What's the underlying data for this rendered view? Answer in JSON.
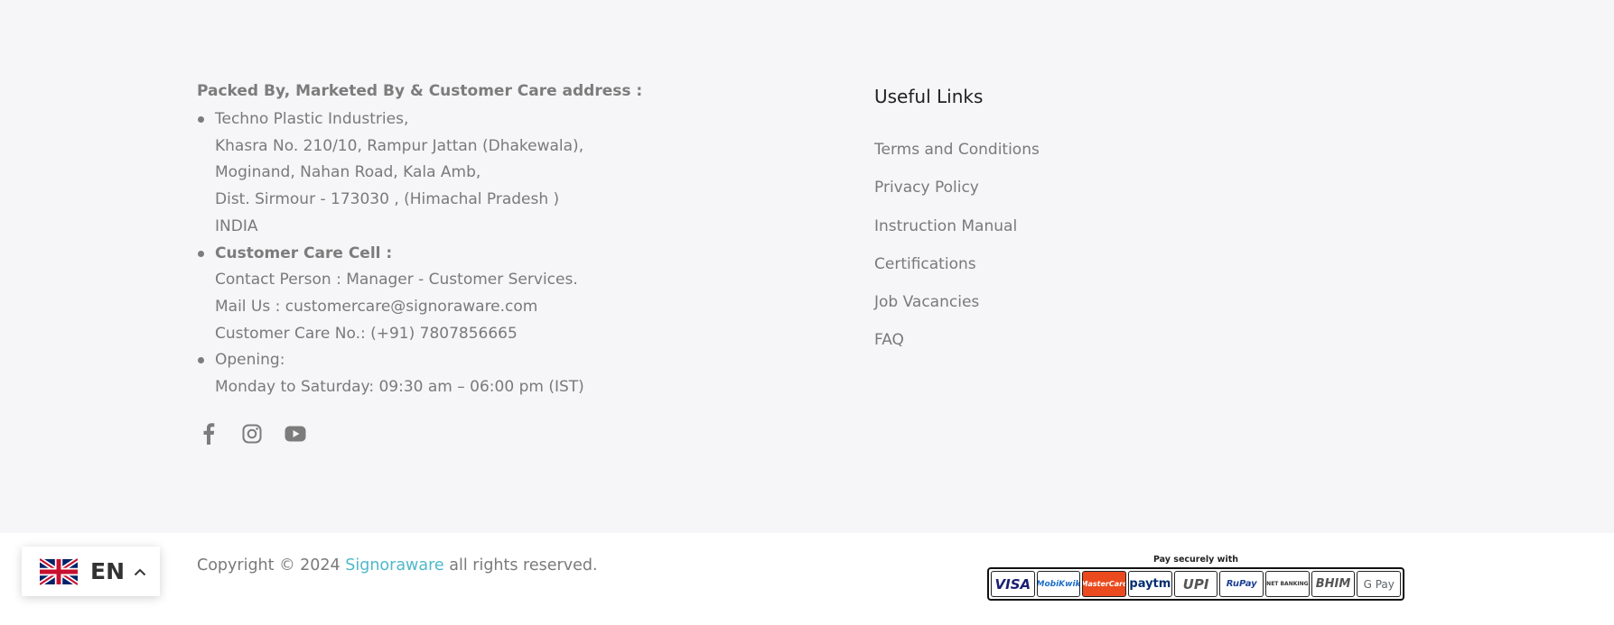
{
  "address": {
    "heading": "Packed By, Marketed By & Customer Care address :",
    "items": [
      {
        "lines": [
          "Techno Plastic Industries,",
          "Khasra No. 210/10, Rampur Jattan (Dhakewala),",
          "Moginand, Nahan Road, Kala Amb,",
          "Dist. Sirmour - 173030 , (Himachal Pradesh )",
          "INDIA"
        ]
      },
      {
        "title": "Customer Care Cell :",
        "lines": [
          "Contact Person : Manager - Customer Services.",
          "Mail Us : customercare@signoraware.com",
          "Customer Care No.: (+91) 7807856665"
        ]
      },
      {
        "lines": [
          "Opening:",
          "Monday to Saturday: 09:30 am – 06:00 pm (IST)"
        ]
      }
    ]
  },
  "social": [
    {
      "name": "facebook-icon"
    },
    {
      "name": "instagram-icon"
    },
    {
      "name": "youtube-icon"
    }
  ],
  "useful_links": {
    "title": "Useful Links",
    "items": [
      "Terms and Conditions",
      "Privacy Policy",
      "Instruction Manual",
      "Certifications",
      "Job Vacancies",
      "FAQ"
    ]
  },
  "copyright": {
    "prefix": "Copyright © 2024",
    "brand": "Signoraware",
    "suffix": "all rights reserved."
  },
  "language": {
    "label": "EN",
    "flag_icon": "uk-flag-icon",
    "chevron_icon": "chevron-up-icon"
  },
  "payment": {
    "title": "Pay securely with",
    "methods": [
      "VISA",
      "MobiKwik",
      "MasterCard",
      "paytm",
      "UPI",
      "RuPay",
      "NET BANKING",
      "BHIM",
      "G Pay"
    ]
  },
  "colors": {
    "accent": "#4fb8c9",
    "background": "#f6f5f7",
    "bottom_bar": "#ffffff",
    "text": "#7a7a7a"
  }
}
